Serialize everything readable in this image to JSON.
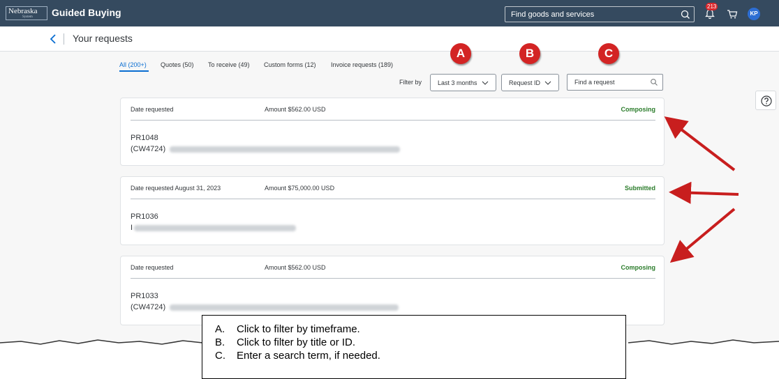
{
  "shell": {
    "logo_text": "Nebraska",
    "logo_sub": "System",
    "app_title": "Guided Buying",
    "search_placeholder": "Find goods and services",
    "notification_count": "213",
    "avatar_initials": "KP"
  },
  "page": {
    "title": "Your requests"
  },
  "tabs": [
    {
      "label": "All (200+)"
    },
    {
      "label": "Quotes (50)"
    },
    {
      "label": "To receive (49)"
    },
    {
      "label": "Custom forms (12)"
    },
    {
      "label": "Invoice requests (189)"
    }
  ],
  "filters": {
    "label": "Filter by",
    "timeframe": "Last 3 months",
    "field": "Request ID",
    "search_placeholder": "Find a request"
  },
  "requests": [
    {
      "date_label": "Date requested",
      "amount": "Amount  $562.00 USD",
      "status": "Composing",
      "id": "PR1048",
      "code": "(CW4724)"
    },
    {
      "date_label": "Date requested August 31, 2023",
      "amount": "Amount  $75,000.00 USD",
      "status": "Submitted",
      "id": "PR1036",
      "code": "I"
    },
    {
      "date_label": "Date requested",
      "amount": "Amount  $562.00 USD",
      "status": "Composing",
      "id": "PR1033",
      "code": "(CW4724)"
    }
  ],
  "callouts": [
    "A",
    "B",
    "C"
  ],
  "legend": [
    {
      "letter": "A.",
      "text": "Click to filter by timeframe."
    },
    {
      "letter": "B.",
      "text": "Click to filter by title or ID."
    },
    {
      "letter": "C.",
      "text": "Enter a search term, if needed."
    }
  ],
  "colors": {
    "shell": "#354a5f",
    "accent": "#0a6ed1",
    "status_green": "#2b7c2b",
    "callout_red": "#d32424"
  }
}
